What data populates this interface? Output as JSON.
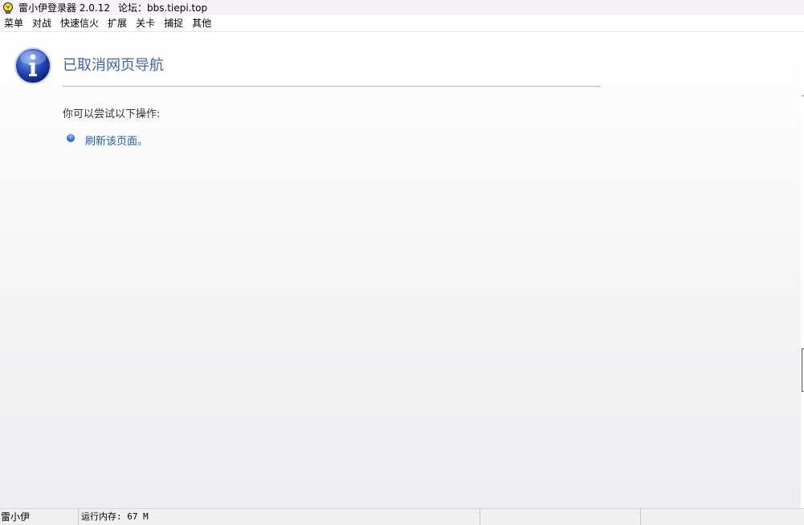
{
  "window": {
    "title": "雷小伊登录器 2.0.12",
    "forum_label": "论坛：bbs.tiepi.top",
    "app_icon": "lightbulb-icon"
  },
  "menubar": {
    "items": [
      "菜单",
      "对战",
      "快速信火",
      "扩展",
      "关卡",
      "捕捉",
      "其他"
    ]
  },
  "page": {
    "icon": "info-icon",
    "heading": "已取消网页导航",
    "suggestion": "你可以尝试以下操作:",
    "actions": [
      {
        "label": "刷新该页面。",
        "bullet_icon": "blue-bullet-icon"
      }
    ]
  },
  "statusbar": {
    "name": "雷小伊",
    "memory": "运行内存: 67 M",
    "pane3": "",
    "pane4": ""
  },
  "colors": {
    "heading": "#4466a4",
    "link": "#1f5ea8",
    "titlebar_bg": "#f6f2f8"
  }
}
